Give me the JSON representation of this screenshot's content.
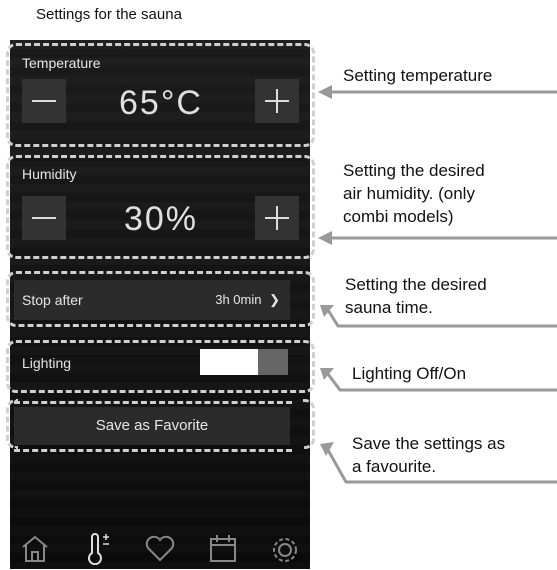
{
  "page_title": "Settings for the sauna",
  "temperature": {
    "label": "Temperature",
    "value": "65°C",
    "minus": "−",
    "plus": "+"
  },
  "humidity": {
    "label": "Humidity",
    "value": "30%",
    "minus": "−",
    "plus": "+"
  },
  "stop_after": {
    "label": "Stop after",
    "value": "3h 0min",
    "chevron": "❯"
  },
  "lighting": {
    "label": "Lighting",
    "state": "on"
  },
  "save_button": {
    "label": "Save as Favorite"
  },
  "nav": {
    "icons": [
      "home-icon",
      "thermometer-icon",
      "heart-icon",
      "calendar-icon",
      "gear-icon"
    ]
  },
  "callouts": {
    "temperature": "Setting temperature",
    "humidity_line1": "Setting the desired",
    "humidity_line2": "air humidity. (only",
    "humidity_line3": "combi models)",
    "time_line1": "Setting the desired",
    "time_line2": "sauna time.",
    "lighting": "Lighting Off/On",
    "favorite_line1": "Save the settings as",
    "favorite_line2": "a favourite."
  },
  "colors": {
    "panel": "#141414",
    "tile": "#2b2b2b",
    "button": "#333333",
    "dash": "#cfcfcf",
    "text": "#e6e6e6"
  }
}
